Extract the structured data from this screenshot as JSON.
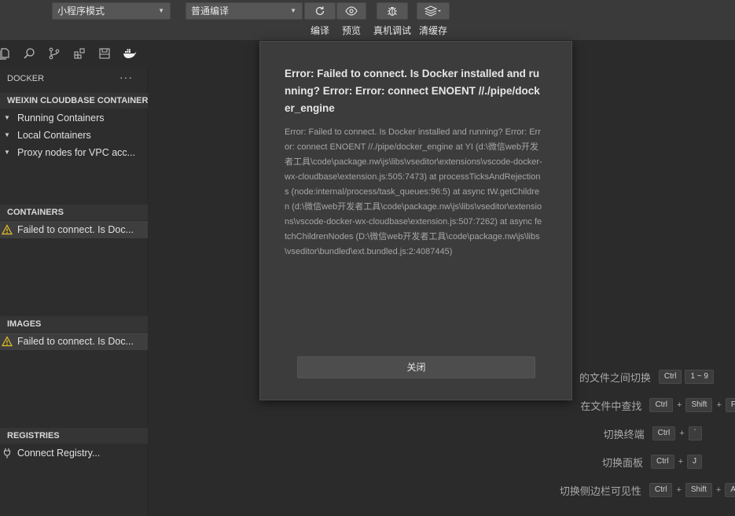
{
  "toolbar": {
    "mode_select": "小程序模式",
    "compile_select": "普通编译",
    "labels": {
      "compile": "编译",
      "preview": "预览",
      "debug": "真机调试",
      "clear_cache": "清缓存"
    }
  },
  "sidebar": {
    "header": "DOCKER",
    "more": "···",
    "sections": {
      "weixin": {
        "title": "WEIXIN CLOUDBASE CONTAINERS",
        "items": [
          "Running Containers",
          "Local Containers",
          "Proxy nodes for VPC acc..."
        ]
      },
      "containers": {
        "title": "CONTAINERS",
        "error": "Failed to connect. Is Doc..."
      },
      "images": {
        "title": "IMAGES",
        "error": "Failed to connect. Is Doc..."
      },
      "registries": {
        "title": "REGISTRIES",
        "connect": "Connect Registry..."
      }
    }
  },
  "shortcuts": [
    {
      "label": "的文件之间切换",
      "keys": [
        "Ctrl",
        "1 ~ 9"
      ]
    },
    {
      "label": "在文件中查找",
      "keys": [
        "Ctrl",
        "Shift",
        "F"
      ]
    },
    {
      "label": "切换终端",
      "keys": [
        "Ctrl",
        "`"
      ]
    },
    {
      "label": "切换面板",
      "keys": [
        "Ctrl",
        "J"
      ]
    },
    {
      "label": "切换侧边栏可见性",
      "keys": [
        "Ctrl",
        "Shift",
        "A"
      ]
    }
  ],
  "dialog": {
    "title": "Error: Failed to connect. Is Docker installed and running? Error: Error: connect ENOENT //./pipe/docker_engine",
    "body": "Error: Failed to connect. Is Docker installed and running? Error: Error: connect ENOENT //./pipe/docker_engine at YI (d:\\微信web开发者工具\\code\\package.nw\\js\\libs\\vseditor\\extensions\\vscode-docker-wx-cloudbase\\extension.js:505:7473) at processTicksAndRejections (node:internal/process/task_queues:96:5) at async tW.getChildren (d:\\微信web开发者工具\\code\\package.nw\\js\\libs\\vseditor\\extensions\\vscode-docker-wx-cloudbase\\extension.js:507:7262) at async fetchChildrenNodes (D:\\微信web开发者工具\\code\\package.nw\\js\\libs\\vseditor\\bundled\\ext.bundled.js:2:4087445)",
    "close_label": "关闭"
  },
  "colors": {
    "warning": "#e8c227",
    "background": "#2b2b2b",
    "dialog": "#3c3c3c"
  }
}
